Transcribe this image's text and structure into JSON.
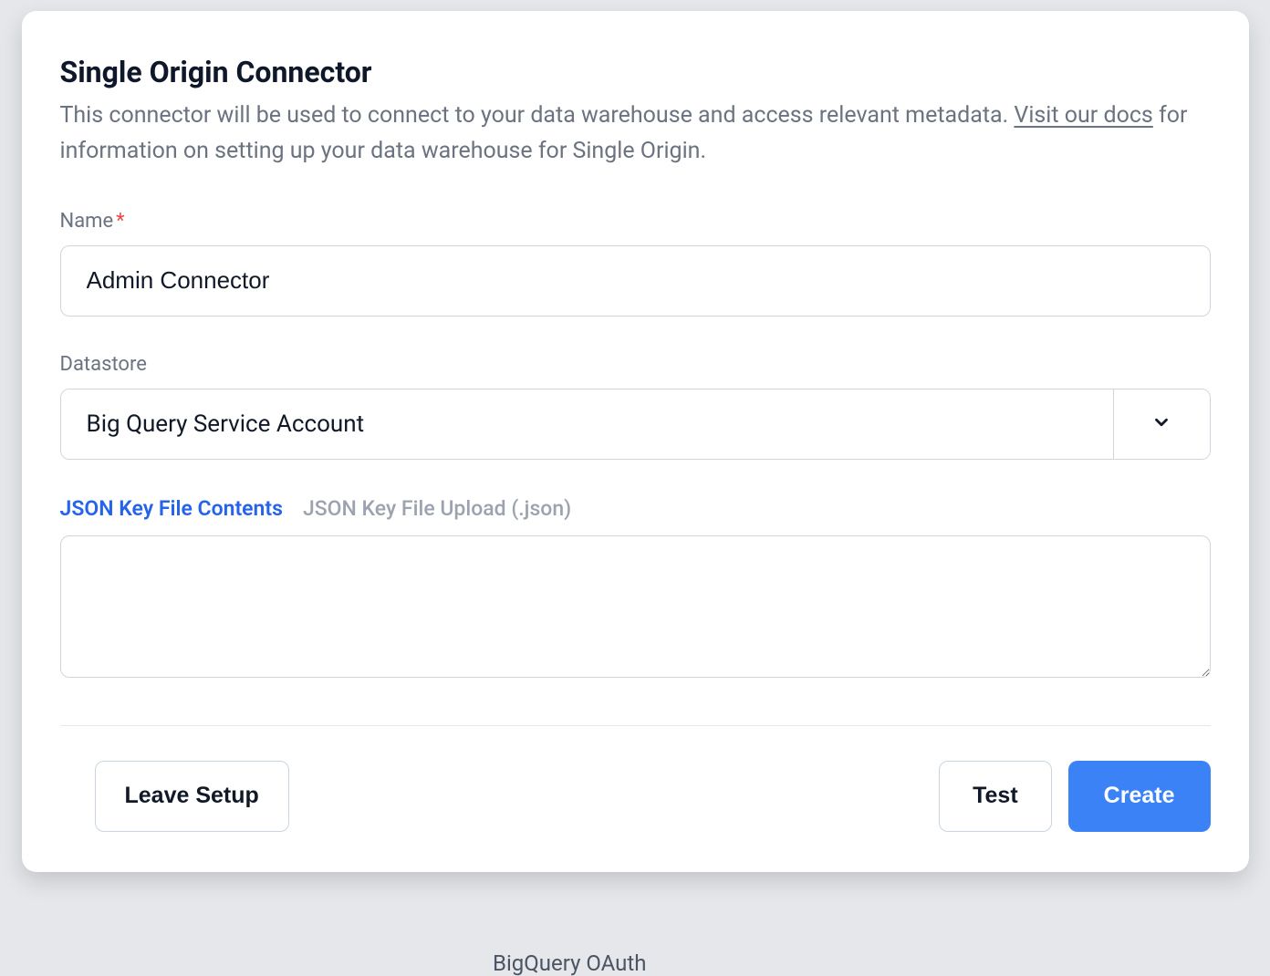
{
  "modal": {
    "title": "Single Origin Connector",
    "description_part1": "This connector will be used to connect to your data warehouse and access relevant metadata. ",
    "description_link": "Visit our docs",
    "description_part2": " for information on setting up your data warehouse for Single Origin."
  },
  "fields": {
    "name": {
      "label": "Name",
      "value": "Admin Connector"
    },
    "datastore": {
      "label": "Datastore",
      "value": "Big Query Service Account"
    }
  },
  "tabs": {
    "active": "JSON Key File Contents",
    "inactive": "JSON Key File Upload (.json)"
  },
  "textarea_value": "",
  "buttons": {
    "leave": "Leave Setup",
    "test": "Test",
    "create": "Create"
  },
  "background": {
    "fragment": "BigQuery OAuth"
  }
}
